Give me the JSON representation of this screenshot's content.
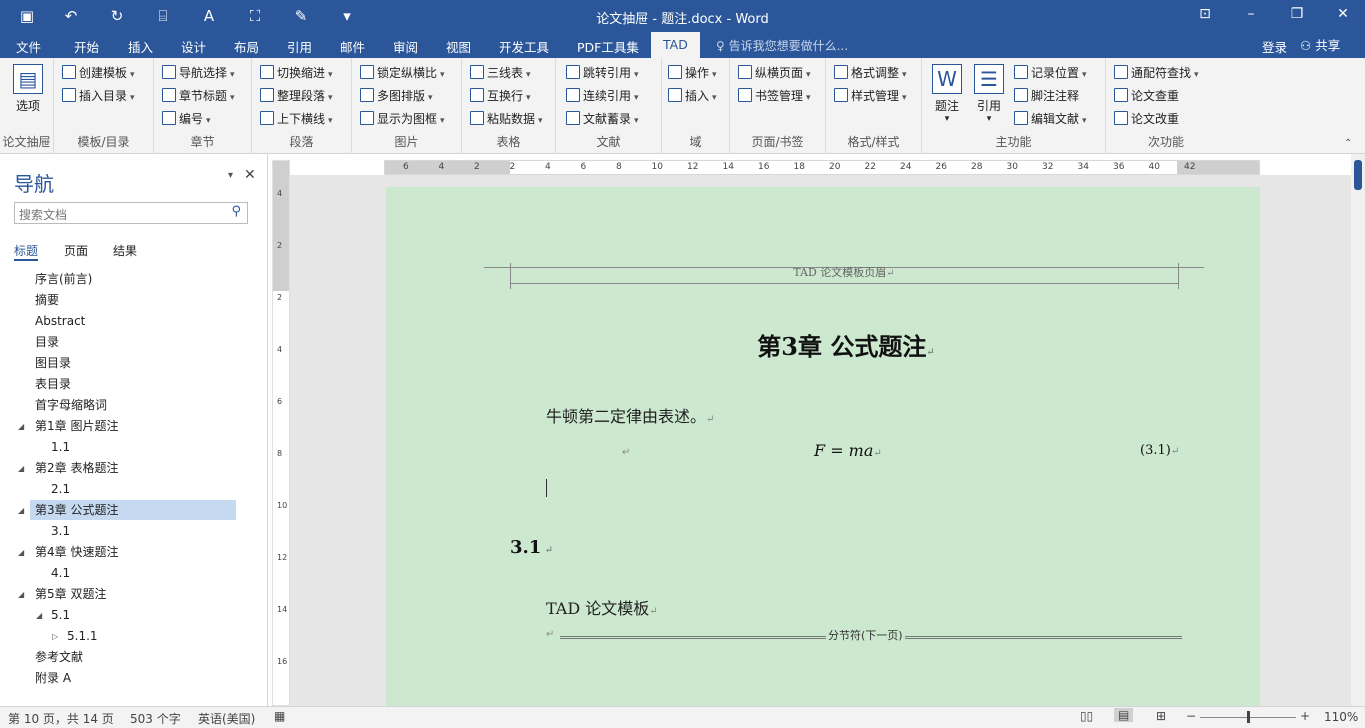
{
  "window": {
    "title": "论文抽屉 - 题注.docx - Word"
  },
  "tabs": [
    "文件",
    "开始",
    "插入",
    "设计",
    "布局",
    "引用",
    "邮件",
    "审阅",
    "视图",
    "开发工具",
    "PDF工具集",
    "TAD"
  ],
  "tellme": "告诉我您想要做什么...",
  "account": {
    "login": "登录",
    "share": "共享"
  },
  "ribbon": {
    "g1": {
      "label": "论文抽屉",
      "big": "选项"
    },
    "g2": {
      "label": "模板/目录",
      "items": [
        "创建模板",
        "插入目录"
      ]
    },
    "g3": {
      "label": "章节",
      "items": [
        "导航选择",
        "章节标题",
        "编号"
      ]
    },
    "g4": {
      "label": "段落",
      "items": [
        "切换缩进",
        "整理段落",
        "上下横线"
      ]
    },
    "g5": {
      "label": "图片",
      "items": [
        "锁定纵横比",
        "多图排版",
        "显示为图框"
      ]
    },
    "g6": {
      "label": "表格",
      "items": [
        "三线表",
        "互换行",
        "粘贴数据"
      ]
    },
    "g7": {
      "label": "文献",
      "items": [
        "跳转引用",
        "连续引用",
        "文献蓄录"
      ]
    },
    "g8": {
      "label": "域",
      "items": [
        "操作",
        "插入"
      ]
    },
    "g9": {
      "label": "页面/书签",
      "items": [
        "纵横页面",
        "书签管理"
      ]
    },
    "g10": {
      "label": "格式/样式",
      "items": [
        "格式调整",
        "样式管理"
      ]
    },
    "g11": {
      "label": "主功能",
      "big1": "题注",
      "big2": "引用",
      "items": [
        "记录位置",
        "脚注注释",
        "编辑文献"
      ]
    },
    "g12": {
      "label": "次功能",
      "items": [
        "通配符查找",
        "论文查重",
        "论文改重"
      ]
    }
  },
  "nav": {
    "title": "导航",
    "search_placeholder": "搜索文档",
    "tabs": [
      "标题",
      "页面",
      "结果"
    ],
    "items": [
      "序言(前言)",
      "摘要",
      "Abstract",
      "目录",
      "图目录",
      "表目录",
      "首字母缩略词",
      "第1章 图片题注",
      "1.1",
      "第2章 表格题注",
      "2.1",
      "第3章 公式题注",
      "3.1",
      "第4章 快速题注",
      "4.1",
      "第5章 双题注",
      "5.1",
      "5.1.1",
      "参考文献",
      "附录 A"
    ]
  },
  "ruler": {
    "h": [
      "6",
      "4",
      "2",
      "2",
      "4",
      "6",
      "8",
      "10",
      "12",
      "14",
      "16",
      "18",
      "20",
      "22",
      "24",
      "26",
      "28",
      "30",
      "32",
      "34",
      "36",
      "40",
      "42"
    ],
    "v": [
      "4",
      "2",
      "2",
      "4",
      "6",
      "8",
      "10",
      "12",
      "14",
      "16"
    ]
  },
  "doc": {
    "header": "TAD 论文模板页眉",
    "chapter": "第3章  公式题注",
    "para1": "牛顿第二定律由表述。",
    "formula": "F = ma",
    "eqno": "(3.1)",
    "section": "3.1",
    "para2": "TAD 论文模板",
    "section_break": "分节符(下一页)"
  },
  "status": {
    "page": "第 10 页，共 14 页",
    "words": "503 个字",
    "lang": "英语(美国)",
    "zoom": "110%"
  }
}
